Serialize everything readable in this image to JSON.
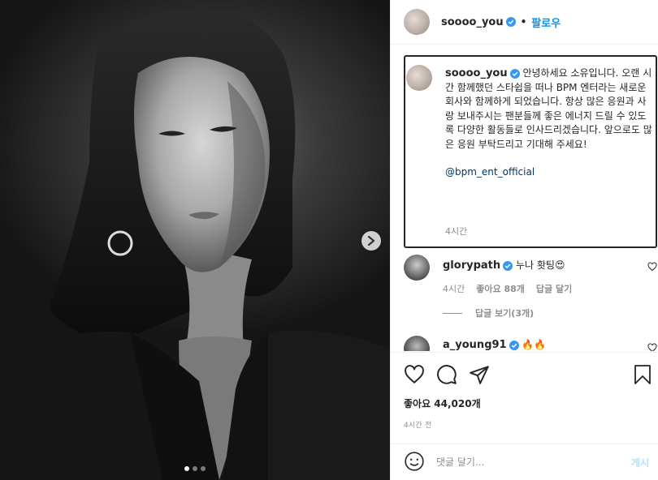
{
  "post": {
    "username": "soooo_you",
    "follow_label": "팔로우",
    "caption": "안녕하세요 소유입니다. 오랜 시간 함께했던 스타쉽을 떠나 BPM 엔터라는 새로운 회사와 함께하게 되었습니다. 항상 많은 응원과 사랑 보내주시는 팬분들께 좋은 에너지 드릴 수 있도록 다양한 활동들로 인사드리겠습니다. 앞으로도 많은 응원 부탁드리고 기대해 주세요!",
    "mention": "@bpm_ent_official",
    "caption_time": "4시간",
    "likes": "좋아요 44,020개",
    "time_ago": "4시간 전"
  },
  "carousel": {
    "slide_count": 3,
    "active_index": 0
  },
  "comments": [
    {
      "username": "glorypath",
      "text": "누나 홧팅😍",
      "time": "4시간",
      "likes": "좋아요 88개",
      "reply_label": "답글 달기",
      "view_replies": "답글 보기(3개)"
    },
    {
      "username": "a_young91",
      "text": "🔥🔥"
    }
  ],
  "add_comment": {
    "placeholder": "댓글 달기...",
    "post_label": "게시"
  },
  "icons": [
    "verified-badge-icon",
    "chevron-right-icon",
    "heart-icon",
    "comment-icon",
    "share-icon",
    "bookmark-icon",
    "emoji-icon"
  ],
  "colors": {
    "accent": "#0095f6",
    "verified": "#3897f0",
    "post_disabled": "#b2dffc",
    "muted": "#8e8e8e"
  }
}
